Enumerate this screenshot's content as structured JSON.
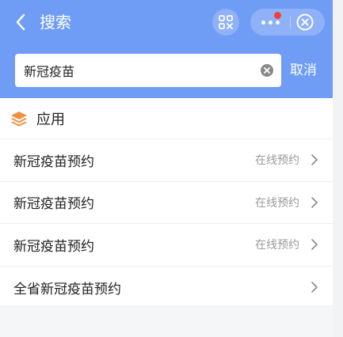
{
  "header": {
    "title": "搜索",
    "icons": {
      "back": "chevron-left-icon",
      "scan": "scan-icon",
      "more": "more-dots-icon",
      "close": "close-circle-icon"
    },
    "notification_dot_color": "#f0403c",
    "background_color": "#6f9cf5"
  },
  "search": {
    "value": "新冠疫苗",
    "placeholder": "",
    "cancel_label": "取消"
  },
  "section": {
    "title": "应用",
    "icon": "layers-icon",
    "icon_color": "#f0903c"
  },
  "results": [
    {
      "title": "新冠疫苗预约",
      "action": "在线预约"
    },
    {
      "title": "新冠疫苗预约",
      "action": "在线预约"
    },
    {
      "title": "新冠疫苗预约",
      "action": "在线预约"
    },
    {
      "title": "全省新冠疫苗预约",
      "action": ""
    }
  ]
}
